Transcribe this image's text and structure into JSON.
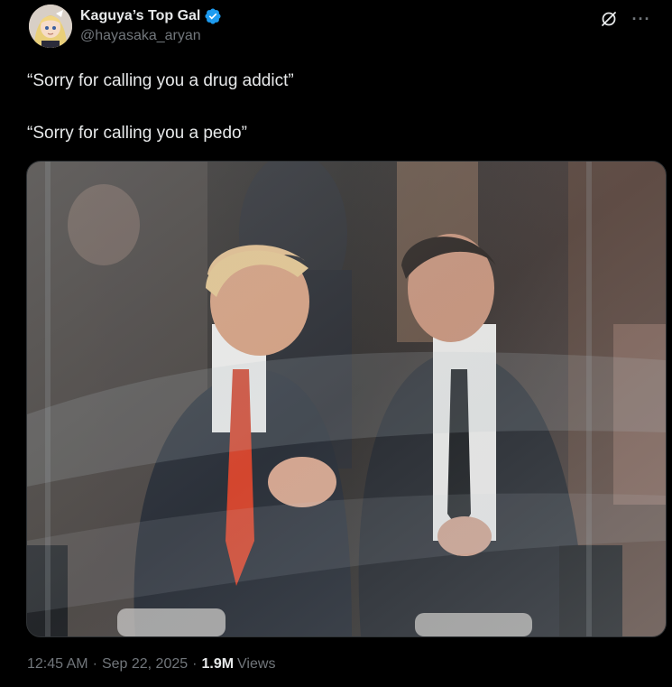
{
  "author": {
    "display_name": "Kaguya’s Top Gal",
    "handle": "@hayasaka_aryan",
    "verified": true,
    "verified_color": "#1d9bf0"
  },
  "actions": {
    "grok_icon": "grok-icon",
    "more_label": "···"
  },
  "tweet": {
    "lines": [
      "“Sorry for calling you a drug addict”",
      "“Sorry for calling you a pedo”"
    ]
  },
  "media": {
    "type": "photo"
  },
  "meta": {
    "time": "12:45 AM",
    "date": "Sep 22, 2025",
    "separator": "·",
    "views_count": "1.9M",
    "views_label": "Views"
  },
  "colors": {
    "background": "#000000",
    "text_primary": "#e7e9ea",
    "text_secondary": "#71767b",
    "border": "#2f3336"
  }
}
